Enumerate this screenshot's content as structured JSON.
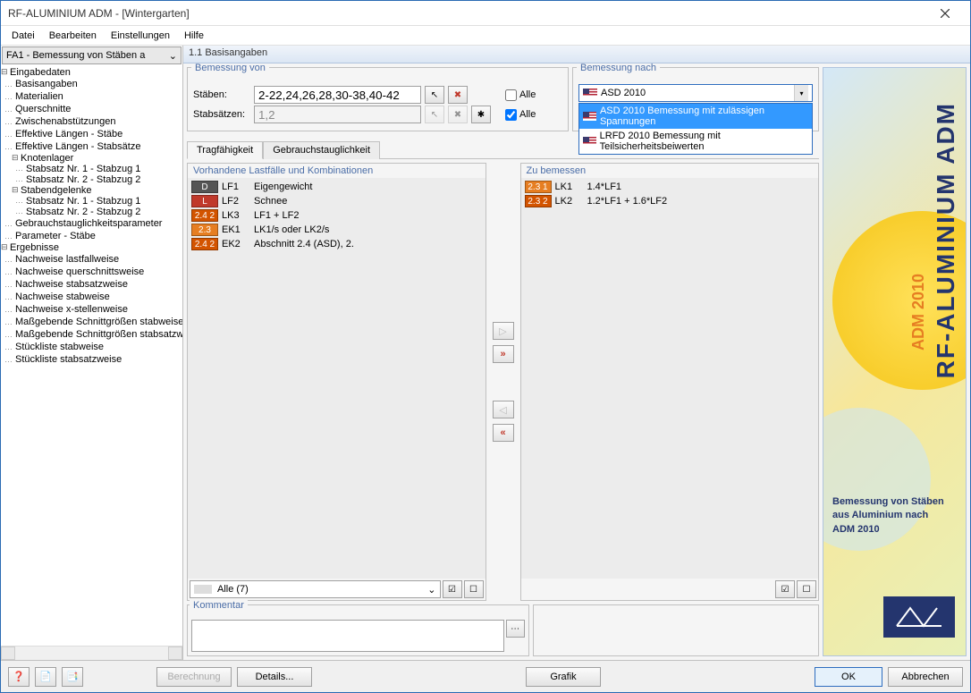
{
  "window": {
    "title": "RF-ALUMINIUM ADM - [Wintergarten]"
  },
  "menu": [
    "Datei",
    "Bearbeiten",
    "Einstellungen",
    "Hilfe"
  ],
  "sidebar": {
    "combo": "FA1 - Bemessung von Stäben a",
    "groups": [
      {
        "label": "Eingabedaten",
        "children": [
          {
            "label": "Basisangaben"
          },
          {
            "label": "Materialien"
          },
          {
            "label": "Querschnitte"
          },
          {
            "label": "Zwischenabstützungen"
          },
          {
            "label": "Effektive Längen - Stäbe"
          },
          {
            "label": "Effektive Längen - Stabsätze"
          },
          {
            "label": "Knotenlager",
            "children": [
              "Stabsatz Nr. 1 - Stabzug 1",
              "Stabsatz Nr. 2 - Stabzug 2"
            ]
          },
          {
            "label": "Stabendgelenke",
            "children": [
              "Stabsatz Nr. 1 - Stabzug 1",
              "Stabsatz Nr. 2 - Stabzug 2"
            ]
          },
          {
            "label": "Gebrauchstauglichkeitsparameter"
          },
          {
            "label": "Parameter - Stäbe"
          }
        ]
      },
      {
        "label": "Ergebnisse",
        "children": [
          {
            "label": "Nachweise lastfallweise"
          },
          {
            "label": "Nachweise querschnittsweise"
          },
          {
            "label": "Nachweise stabsatzweise"
          },
          {
            "label": "Nachweise stabweise"
          },
          {
            "label": "Nachweise x-stellenweise"
          },
          {
            "label": "Maßgebende Schnittgrößen stabweise"
          },
          {
            "label": "Maßgebende Schnittgrößen stabsatzweise"
          },
          {
            "label": "Stückliste stabweise"
          },
          {
            "label": "Stückliste stabsatzweise"
          }
        ]
      }
    ]
  },
  "main": {
    "header": "1.1 Basisangaben",
    "bemessung_von": {
      "title": "Bemessung von",
      "rows": [
        {
          "label": "Stäben:",
          "value": "2-22,24,26,28,30-38,40-42",
          "alle": false,
          "alle_label": "Alle",
          "editable": true
        },
        {
          "label": "Stabsätzen:",
          "value": "1,2",
          "alle": true,
          "alle_label": "Alle",
          "editable": false
        }
      ]
    },
    "bemessung_nach": {
      "title": "Bemessung nach",
      "selected": "ASD 2010",
      "options": [
        {
          "label": "ASD 2010  Bemessung mit zulässigen Spannungen",
          "selected": true
        },
        {
          "label": "LRFD 2010 Bemessung mit Teilsicherheitsbeiwerten",
          "selected": false
        }
      ]
    },
    "tabs": [
      {
        "label": "Tragfähigkeit",
        "active": true
      },
      {
        "label": "Gebrauchstauglichkeit",
        "active": false
      }
    ],
    "left_list": {
      "title": "Vorhandene Lastfälle und Kombinationen",
      "items": [
        {
          "badge": "D",
          "cls": "d",
          "code": "LF1",
          "desc": "Eigengewicht"
        },
        {
          "badge": "L",
          "cls": "l",
          "code": "LF2",
          "desc": "Schnee"
        },
        {
          "badge": "2.4 2",
          "cls": "c242",
          "code": "LK3",
          "desc": "LF1 + LF2"
        },
        {
          "badge": "2.3",
          "cls": "c23",
          "code": "EK1",
          "desc": "LK1/s oder LK2/s"
        },
        {
          "badge": "2.4 2",
          "cls": "c242",
          "code": "EK2",
          "desc": "Abschnitt 2.4 (ASD), 2."
        }
      ],
      "footer_select": "Alle (7)"
    },
    "right_list": {
      "title": "Zu bemessen",
      "items": [
        {
          "badge": "2.3 1",
          "cls": "c231",
          "code": "LK1",
          "desc": "1.4*LF1"
        },
        {
          "badge": "2.3 2",
          "cls": "c232",
          "code": "LK2",
          "desc": "1.2*LF1 + 1.6*LF2"
        }
      ]
    },
    "kommentar": {
      "title": "Kommentar",
      "value": ""
    }
  },
  "rightpanel": {
    "title": "RF-ALUMINIUM ADM",
    "sub": "ADM 2010",
    "desc1": "Bemessung von Stäben",
    "desc2": "aus Aluminium nach",
    "desc3": "ADM 2010"
  },
  "footer": {
    "berechnung": "Berechnung",
    "details": "Details...",
    "grafik": "Grafik",
    "ok": "OK",
    "abbrechen": "Abbrechen"
  }
}
